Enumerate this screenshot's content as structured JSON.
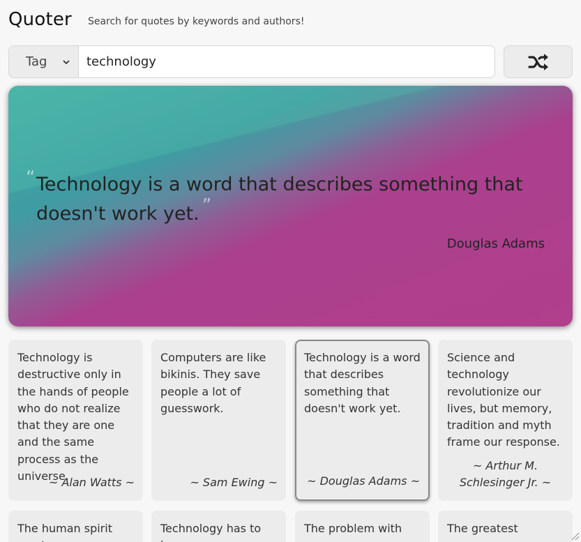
{
  "header": {
    "title": "Quoter",
    "subtitle": "Search for quotes by keywords and authors!"
  },
  "search": {
    "mode_label": "Tag",
    "query": "technology"
  },
  "featured": {
    "text": "Technology is a word that describes something that doesn't work yet.",
    "author": "Douglas Adams"
  },
  "cards": [
    {
      "text": "Technology is destructive only in the hands of people who do not realize that they are one and the same process as the universe.",
      "author": "~ Alan Watts ~"
    },
    {
      "text": "Computers are like bikinis. They save people a lot of guesswork.",
      "author": "~ Sam Ewing ~"
    },
    {
      "text": "Technology is a word that describes something that doesn't work yet.",
      "author": "~ Douglas Adams ~"
    },
    {
      "text": "Science and technology revolutionize our lives, but memory, tradition and myth frame our response.",
      "author": "~ Arthur M. Schlesinger Jr. ~"
    },
    {
      "text": "The human spirit must",
      "author": ""
    },
    {
      "text": "Technology has to be",
      "author": ""
    },
    {
      "text": "The problem with",
      "author": ""
    },
    {
      "text": "The greatest",
      "author": ""
    }
  ],
  "colors": {
    "background": "#f7f7f7",
    "card": "#ececec",
    "hero_teal": "#3e9ca2",
    "hero_magenta": "#b03f8c"
  },
  "icons": {
    "shuffle": "shuffle-icon",
    "dropdown": "chevron-down-icon"
  }
}
